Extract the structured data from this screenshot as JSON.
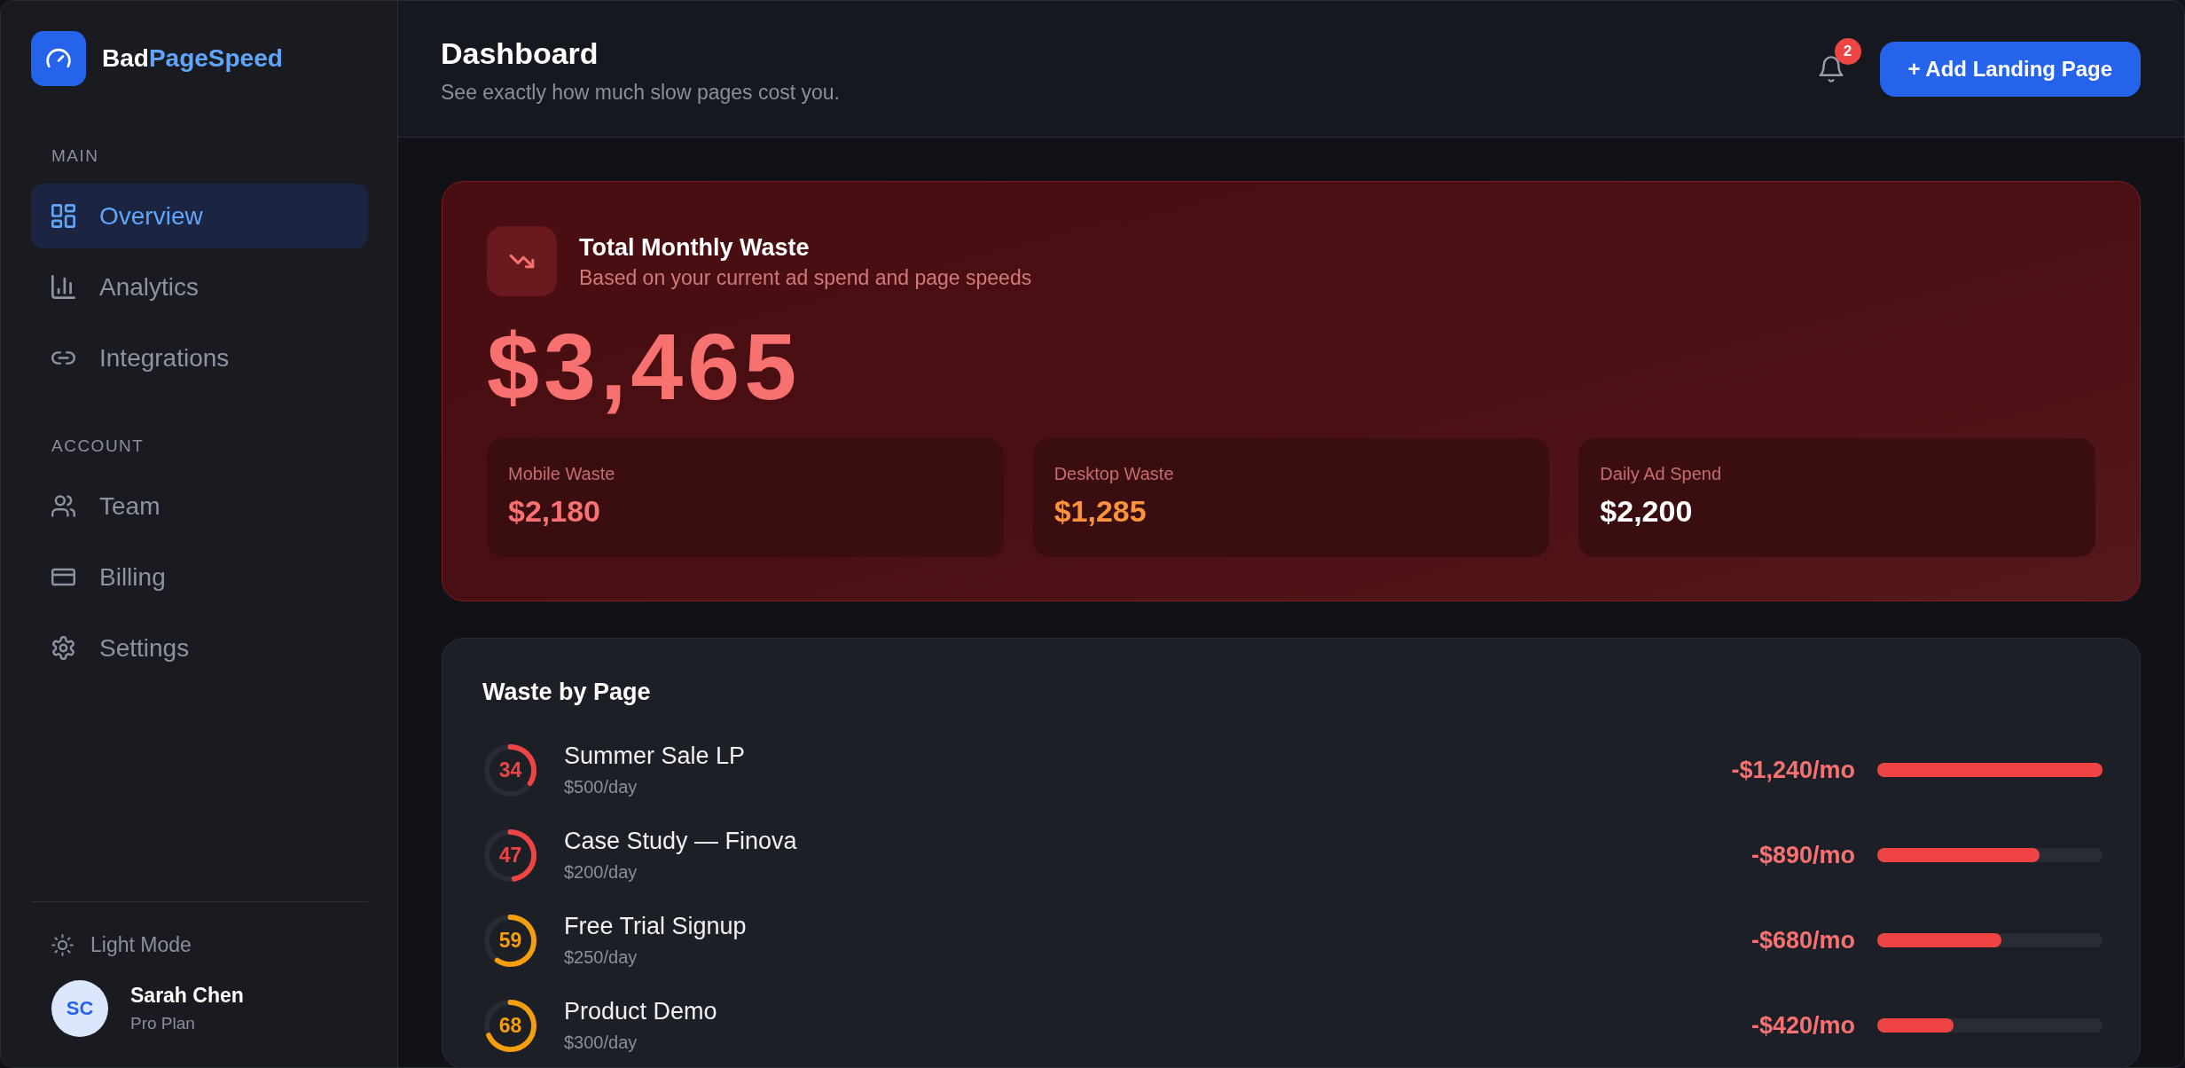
{
  "brand": {
    "prefix": "Bad",
    "highlight": "PageSpeed"
  },
  "sidebar": {
    "sections": [
      {
        "heading": "MAIN",
        "items": [
          {
            "label": "Overview",
            "selected": true
          },
          {
            "label": "Analytics",
            "selected": false
          },
          {
            "label": "Integrations",
            "selected": false
          }
        ]
      },
      {
        "heading": "ACCOUNT",
        "items": [
          {
            "label": "Team",
            "selected": false
          },
          {
            "label": "Billing",
            "selected": false
          },
          {
            "label": "Settings",
            "selected": false
          }
        ]
      }
    ],
    "theme_toggle": {
      "label": "Light Mode"
    },
    "user": {
      "initials": "SC",
      "name": "Sarah Chen",
      "plan": "Pro Plan"
    }
  },
  "header": {
    "title": "Dashboard",
    "subtitle": "See exactly how much slow pages cost you.",
    "notifications": {
      "count": "2"
    },
    "action_button": {
      "label": "+ Add Landing Page"
    }
  },
  "waste_summary": {
    "title": "Total Monthly Waste",
    "subtitle": "Based on your current ad spend and page speeds",
    "total": "$3,465",
    "metrics": [
      {
        "label": "Mobile Waste",
        "value": "$2,180",
        "color": "#f87171"
      },
      {
        "label": "Desktop Waste",
        "value": "$1,285",
        "color": "#fb923c"
      },
      {
        "label": "Daily Ad Spend",
        "value": "$2,200",
        "color": "#ffffff"
      }
    ]
  },
  "waste_by_page": {
    "title": "Waste by Page",
    "pages": [
      {
        "score": {
          "text": "34",
          "level": 0.34,
          "color": "#ef4444"
        },
        "name": "Summer Sale LP",
        "daily_spend": "$500/day",
        "monthly_waste": "-$1,240/mo",
        "level": 1.0
      },
      {
        "score": {
          "text": "47",
          "level": 0.47,
          "color": "#ef4444"
        },
        "name": "Case Study — Finova",
        "daily_spend": "$200/day",
        "monthly_waste": "-$890/mo",
        "level": 0.72
      },
      {
        "score": {
          "text": "59",
          "level": 0.59,
          "color": "#f59e0b"
        },
        "name": "Free Trial Signup",
        "daily_spend": "$250/day",
        "monthly_waste": "-$680/mo",
        "level": 0.55
      },
      {
        "score": {
          "text": "68",
          "level": 0.68,
          "color": "#f59e0b"
        },
        "name": "Product Demo",
        "daily_spend": "$300/day",
        "monthly_waste": "-$420/mo",
        "level": 0.34
      }
    ]
  }
}
